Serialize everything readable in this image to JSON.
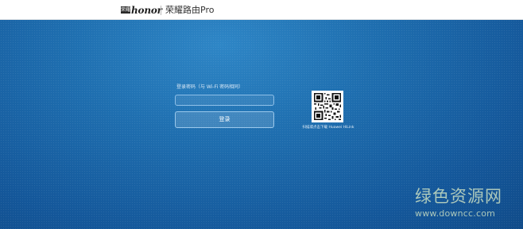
{
  "header": {
    "logo_mark": "荣耀",
    "logo_word": "honor",
    "product_name": "荣耀路由Pro"
  },
  "login": {
    "password_label": "登录密码（与 Wi-Fi 密码相同）",
    "password_value": "",
    "login_button": "登录"
  },
  "qr": {
    "caption": "扫描或点击下载 Huawei HiLink"
  },
  "watermark": {
    "name": "绿色资源网",
    "url": "www.downcc.com"
  },
  "colors": {
    "header_bg": "#ffffff",
    "main_bg": "#1a65a8",
    "accent_border": "#8fc0e8",
    "watermark": "#c6dcc2"
  }
}
